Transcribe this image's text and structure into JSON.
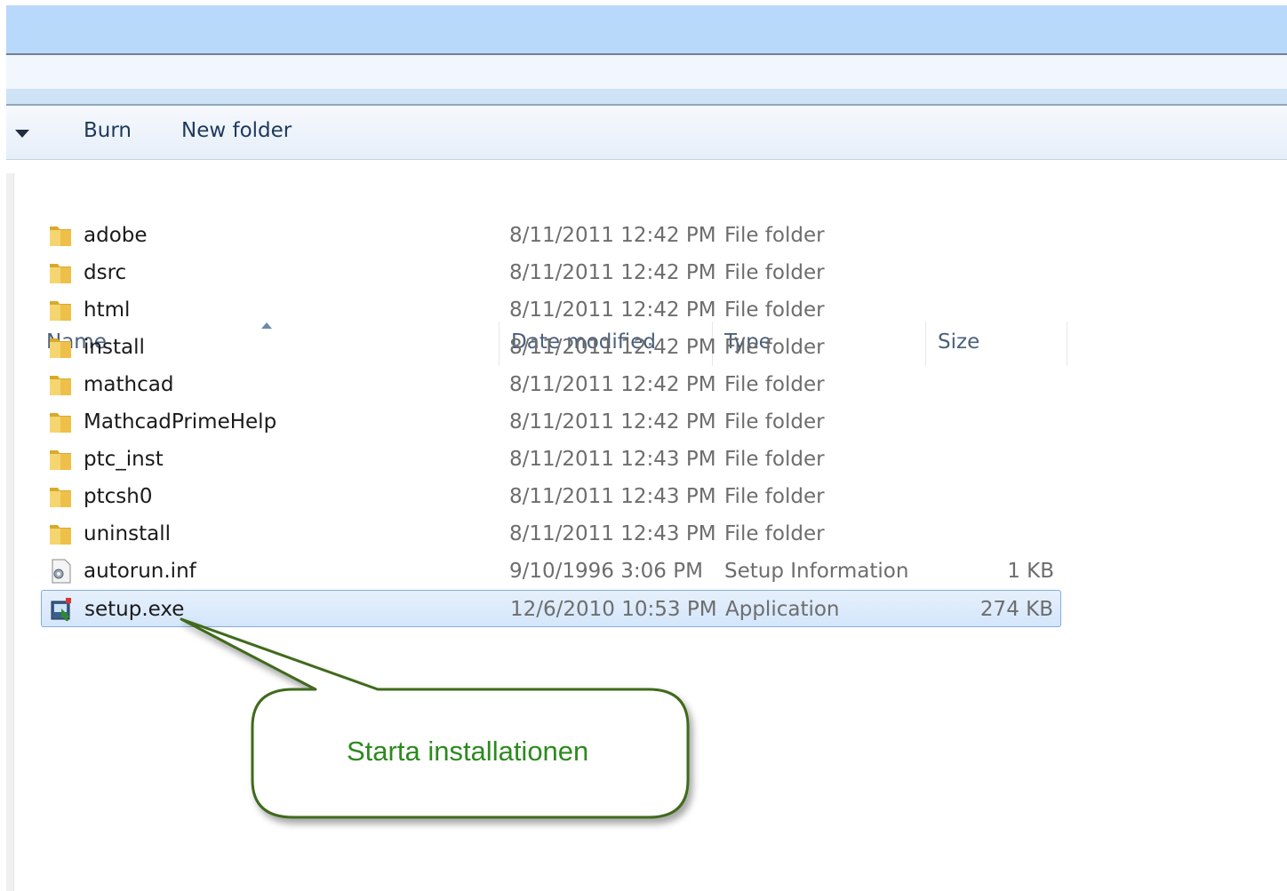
{
  "toolbar": {
    "burn_label": "Burn",
    "new_folder_label": "New folder"
  },
  "columns": {
    "name": "Name",
    "date_modified": "Date modified",
    "type": "Type",
    "size": "Size"
  },
  "rows": [
    {
      "name": "adobe",
      "date": "8/11/2011 12:42 PM",
      "type": "File folder",
      "size": "",
      "icon": "folder-icon"
    },
    {
      "name": "dsrc",
      "date": "8/11/2011 12:42 PM",
      "type": "File folder",
      "size": "",
      "icon": "folder-icon"
    },
    {
      "name": "html",
      "date": "8/11/2011 12:42 PM",
      "type": "File folder",
      "size": "",
      "icon": "folder-icon"
    },
    {
      "name": "install",
      "date": "8/11/2011 12:42 PM",
      "type": "File folder",
      "size": "",
      "icon": "folder-icon"
    },
    {
      "name": "mathcad",
      "date": "8/11/2011 12:42 PM",
      "type": "File folder",
      "size": "",
      "icon": "folder-icon"
    },
    {
      "name": "MathcadPrimeHelp",
      "date": "8/11/2011 12:42 PM",
      "type": "File folder",
      "size": "",
      "icon": "folder-icon"
    },
    {
      "name": "ptc_inst",
      "date": "8/11/2011 12:43 PM",
      "type": "File folder",
      "size": "",
      "icon": "folder-icon"
    },
    {
      "name": "ptcsh0",
      "date": "8/11/2011 12:43 PM",
      "type": "File folder",
      "size": "",
      "icon": "folder-icon"
    },
    {
      "name": "uninstall",
      "date": "8/11/2011 12:43 PM",
      "type": "File folder",
      "size": "",
      "icon": "folder-icon"
    },
    {
      "name": "autorun.inf",
      "date": "9/10/1996 3:06 PM",
      "type": "Setup Information",
      "size": "1 KB",
      "icon": "setup-info-file-icon"
    },
    {
      "name": "setup.exe",
      "date": "12/6/2010 10:53 PM",
      "type": "Application",
      "size": "274 KB",
      "icon": "setup-application-icon",
      "selected": true
    }
  ],
  "callout": {
    "text": "Starta installationen"
  },
  "colors": {
    "title_band": "#b9d9fa",
    "selection": "#d4e6fb",
    "callout_text": "#2c8a1e",
    "callout_border": "#3f6b1e"
  }
}
